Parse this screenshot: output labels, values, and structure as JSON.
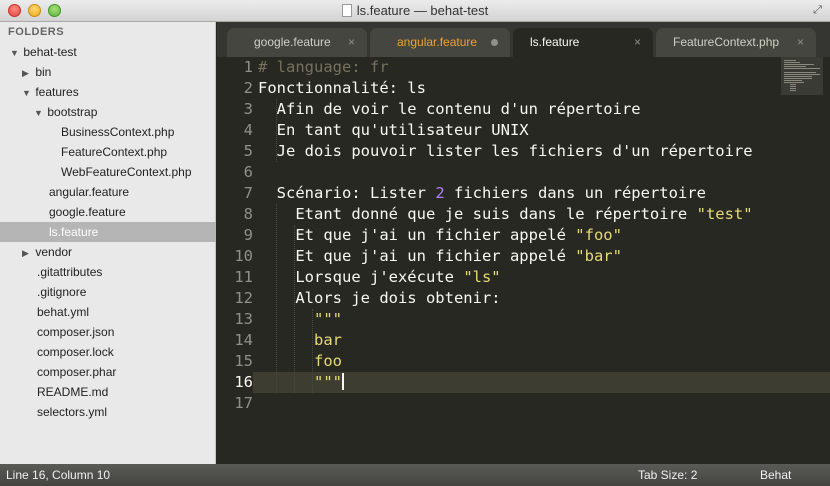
{
  "window": {
    "title": "ls.feature — behat-test"
  },
  "sidebar": {
    "header": "FOLDERS",
    "items": [
      {
        "label": "behat-test",
        "arrow": "▼"
      },
      {
        "label": "bin",
        "arrow": "▶"
      },
      {
        "label": "features",
        "arrow": "▼"
      },
      {
        "label": "bootstrap",
        "arrow": "▼"
      },
      {
        "label": "BusinessContext.php",
        "arrow": ""
      },
      {
        "label": "FeatureContext.php",
        "arrow": ""
      },
      {
        "label": "WebFeatureContext.php",
        "arrow": ""
      },
      {
        "label": "angular.feature",
        "arrow": ""
      },
      {
        "label": "google.feature",
        "arrow": ""
      },
      {
        "label": "ls.feature",
        "arrow": ""
      },
      {
        "label": "vendor",
        "arrow": "▶"
      },
      {
        "label": ".gitattributes",
        "arrow": ""
      },
      {
        "label": ".gitignore",
        "arrow": ""
      },
      {
        "label": "behat.yml",
        "arrow": ""
      },
      {
        "label": "composer.json",
        "arrow": ""
      },
      {
        "label": "composer.lock",
        "arrow": ""
      },
      {
        "label": "composer.phar",
        "arrow": ""
      },
      {
        "label": "README.md",
        "arrow": ""
      },
      {
        "label": "selectors.yml",
        "arrow": ""
      }
    ]
  },
  "tabs": [
    {
      "label": "google.feature",
      "close": "×"
    },
    {
      "label": "angular.feature",
      "close": ""
    },
    {
      "label": "ls.feature",
      "close": "×"
    },
    {
      "label": "FeatureContext.php",
      "close": "×"
    }
  ],
  "editor": {
    "line_numbers": [
      "1",
      "2",
      "3",
      "4",
      "5",
      "6",
      "7",
      "8",
      "9",
      "10",
      "11",
      "12",
      "13",
      "14",
      "15",
      "16",
      "17"
    ],
    "lines": [
      [
        {
          "t": "# language: fr",
          "c": "comment"
        }
      ],
      [
        {
          "t": "Fonctionnalité: ls",
          "c": ""
        }
      ],
      [
        {
          "t": "  Afin de voir le contenu d'un répertoire",
          "c": ""
        }
      ],
      [
        {
          "t": "  En tant qu'utilisateur UNIX",
          "c": ""
        }
      ],
      [
        {
          "t": "  Je dois pouvoir lister les fichiers d'un répertoire",
          "c": ""
        }
      ],
      [
        {
          "t": "",
          "c": ""
        }
      ],
      [
        {
          "t": "  Scénario: Lister ",
          "c": ""
        },
        {
          "t": "2",
          "c": "number"
        },
        {
          "t": " fichiers dans un répertoire",
          "c": ""
        }
      ],
      [
        {
          "t": "    Etant donné que je suis dans le répertoire ",
          "c": ""
        },
        {
          "t": "\"test\"",
          "c": "string"
        }
      ],
      [
        {
          "t": "    Et que j'ai un fichier appelé ",
          "c": ""
        },
        {
          "t": "\"foo\"",
          "c": "string"
        }
      ],
      [
        {
          "t": "    Et que j'ai un fichier appelé ",
          "c": ""
        },
        {
          "t": "\"bar\"",
          "c": "string"
        }
      ],
      [
        {
          "t": "    Lorsque j'exécute ",
          "c": ""
        },
        {
          "t": "\"ls\"",
          "c": "string"
        }
      ],
      [
        {
          "t": "    Alors je dois obtenir:",
          "c": ""
        }
      ],
      [
        {
          "t": "      ",
          "c": ""
        },
        {
          "t": "\"\"\"",
          "c": "string"
        }
      ],
      [
        {
          "t": "      ",
          "c": ""
        },
        {
          "t": "bar",
          "c": "string"
        }
      ],
      [
        {
          "t": "      ",
          "c": ""
        },
        {
          "t": "foo",
          "c": "string"
        }
      ],
      [
        {
          "t": "      ",
          "c": ""
        },
        {
          "t": "\"\"\"",
          "c": "string"
        }
      ],
      [
        {
          "t": "",
          "c": ""
        }
      ]
    ],
    "current_line": 16
  },
  "statusbar": {
    "position": "Line 16, Column 10",
    "tab_size": "Tab Size: 2",
    "syntax": "Behat"
  },
  "colors": {
    "background": "#272822",
    "foreground": "#f8f8f2",
    "comment": "#75715e",
    "string": "#e6db74",
    "number": "#ae81ff",
    "dirty_tab": "#f0a030"
  }
}
